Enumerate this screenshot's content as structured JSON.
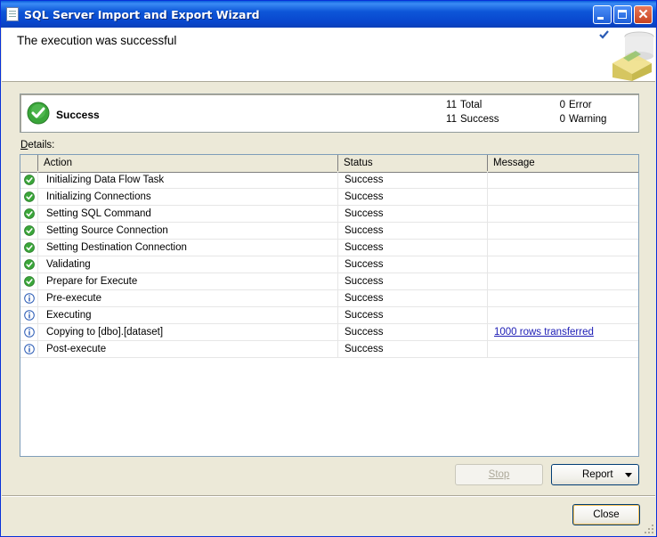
{
  "window": {
    "title": "SQL Server Import and Export Wizard"
  },
  "header": {
    "title": "The execution was successful"
  },
  "summary": {
    "status": "Success",
    "total_count": "11",
    "total_label": "Total",
    "success_count": "11",
    "success_label": "Success",
    "error_count": "0",
    "error_label": "Error",
    "warning_count": "0",
    "warning_label": "Warning"
  },
  "details": {
    "label_prefix": "D",
    "label_rest": "etails:",
    "columns": [
      "Action",
      "Status",
      "Message"
    ],
    "rows": [
      {
        "icon": "success-icon",
        "action": "Initializing Data Flow Task",
        "status": "Success",
        "message": ""
      },
      {
        "icon": "success-icon",
        "action": "Initializing Connections",
        "status": "Success",
        "message": ""
      },
      {
        "icon": "success-icon",
        "action": "Setting SQL Command",
        "status": "Success",
        "message": ""
      },
      {
        "icon": "success-icon",
        "action": "Setting Source Connection",
        "status": "Success",
        "message": ""
      },
      {
        "icon": "success-icon",
        "action": "Setting Destination Connection",
        "status": "Success",
        "message": ""
      },
      {
        "icon": "success-icon",
        "action": "Validating",
        "status": "Success",
        "message": ""
      },
      {
        "icon": "success-icon",
        "action": "Prepare for Execute",
        "status": "Success",
        "message": ""
      },
      {
        "icon": "info-icon",
        "action": "Pre-execute",
        "status": "Success",
        "message": ""
      },
      {
        "icon": "info-icon",
        "action": "Executing",
        "status": "Success",
        "message": ""
      },
      {
        "icon": "info-icon",
        "action": "Copying to [dbo].[dataset]",
        "status": "Success",
        "message": "1000 rows transferred"
      },
      {
        "icon": "info-icon",
        "action": "Post-execute",
        "status": "Success",
        "message": ""
      }
    ]
  },
  "buttons": {
    "stop": "Stop",
    "report": "Report",
    "close": "Close"
  },
  "colors": {
    "titlebar": "#0a50d8",
    "success_green": "#3aa63a",
    "info_blue": "#2a5bb5",
    "link": "#1c1cb5"
  }
}
